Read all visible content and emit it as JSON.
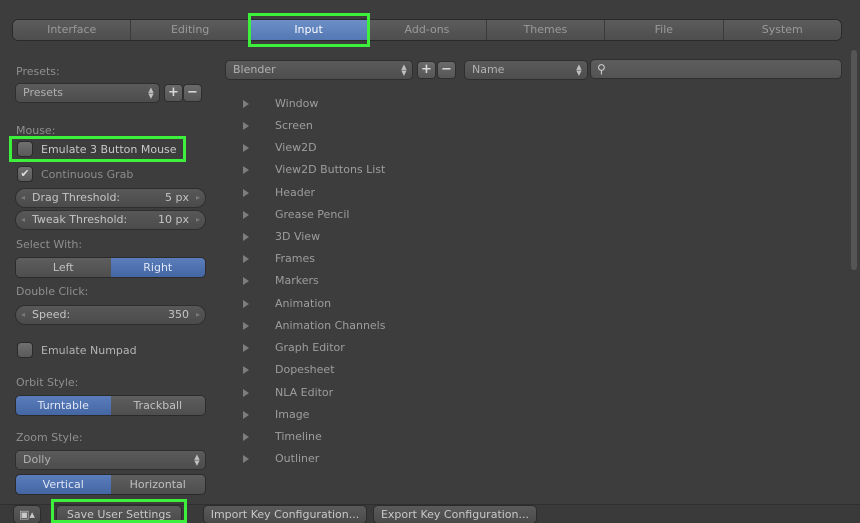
{
  "tabs": [
    "Interface",
    "Editing",
    "Input",
    "Add-ons",
    "Themes",
    "File",
    "System"
  ],
  "active_tab": "Input",
  "left": {
    "presets_label": "Presets:",
    "presets_value": "Presets",
    "mouse_label": "Mouse:",
    "emulate3": "Emulate 3 Button Mouse",
    "continuous_grab": "Continuous Grab",
    "drag_threshold": {
      "label": "Drag Threshold:",
      "value": "5 px"
    },
    "tweak_threshold": {
      "label": "Tweak Threshold:",
      "value": "10 px"
    },
    "select_with_label": "Select With:",
    "select_with": [
      "Left",
      "Right"
    ],
    "double_click_label": "Double Click:",
    "speed": {
      "label": "Speed:",
      "value": "350"
    },
    "emulate_numpad": "Emulate Numpad",
    "orbit_style_label": "Orbit Style:",
    "orbit_style": [
      "Turntable",
      "Trackball"
    ],
    "zoom_style_label": "Zoom Style:",
    "zoom_style_value": "Dolly",
    "zoom_axis": [
      "Vertical",
      "Horizontal"
    ]
  },
  "right": {
    "keyconfig": "Blender",
    "filter_type": "Name",
    "items": [
      "Window",
      "Screen",
      "View2D",
      "View2D Buttons List",
      "Header",
      "Grease Pencil",
      "3D View",
      "Frames",
      "Markers",
      "Animation",
      "Animation Channels",
      "Graph Editor",
      "Dopesheet",
      "NLA Editor",
      "Image",
      "Timeline",
      "Outliner"
    ]
  },
  "bottom": {
    "save": "Save User Settings",
    "import": "Import Key Configuration...",
    "export": "Export Key Configuration..."
  },
  "colors": {
    "highlight": "#3cf03c",
    "accent": "#5478b4"
  }
}
